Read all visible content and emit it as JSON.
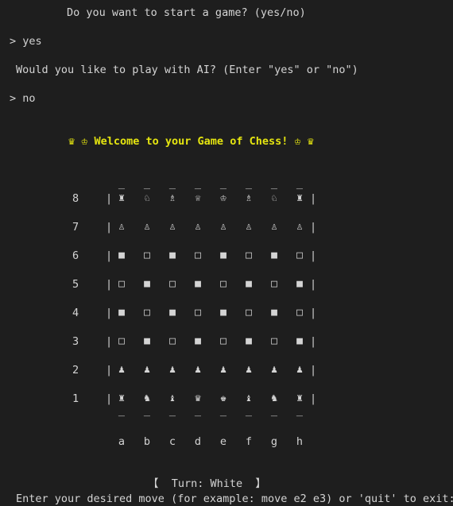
{
  "terminal": {
    "line1": "Do you want to start a game? (yes/no)",
    "answer1": "> yes",
    "line2": "Would you like to play with AI? (Enter \"yes\" or \"no\")",
    "answer2": "> no",
    "welcome": "♛ ♔ Welcome to your Game of Chess! ♔ ♛",
    "turn": "【  Turn: White  】",
    "prompt": "Enter your desired move (for example: move e2 e3) or 'quit' to exit:"
  },
  "board": {
    "ranks": [
      "8",
      "7",
      "6",
      "5",
      "4",
      "3",
      "2",
      "1"
    ],
    "files": [
      "a",
      "b",
      "c",
      "d",
      "e",
      "f",
      "g",
      "h"
    ],
    "rows": [
      [
        "♜",
        "♘",
        "♗",
        "♕",
        "♔",
        "♗",
        "♘",
        "♜"
      ],
      [
        "♙",
        "♙",
        "♙",
        "♙",
        "♙",
        "♙",
        "♙",
        "♙"
      ],
      [
        "■",
        "□",
        "■",
        "□",
        "■",
        "□",
        "■",
        "□"
      ],
      [
        "□",
        "■",
        "□",
        "■",
        "□",
        "■",
        "□",
        "■"
      ],
      [
        "■",
        "□",
        "■",
        "□",
        "■",
        "□",
        "■",
        "□"
      ],
      [
        "□",
        "■",
        "□",
        "■",
        "□",
        "■",
        "□",
        "■"
      ],
      [
        "♟",
        "♟",
        "♟",
        "♟",
        "♟",
        "♟",
        "♟",
        "♟"
      ],
      [
        "♜",
        "♞",
        "♝",
        "♛",
        "♚",
        "♝",
        "♞",
        "♜"
      ]
    ],
    "border_left": "|",
    "border_right": "|",
    "edge": "_"
  },
  "colors": {
    "background": "#1e1e1e",
    "text": "#d4d4d4",
    "accent": "#e5e510"
  }
}
